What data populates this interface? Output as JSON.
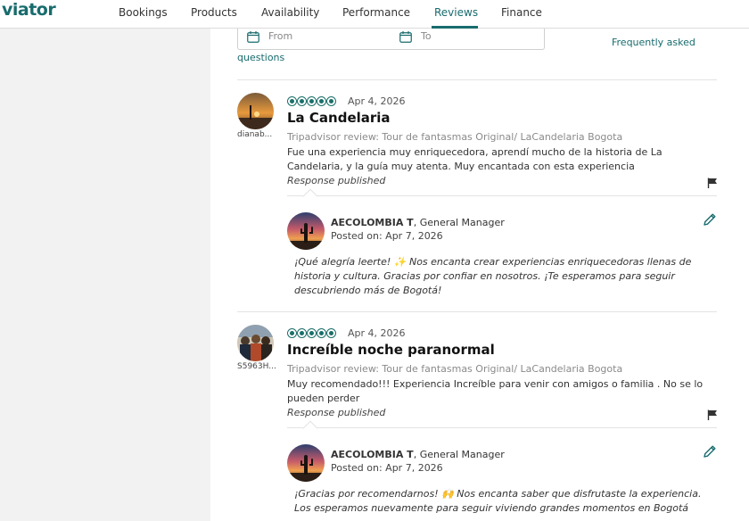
{
  "brand": {
    "logo": "viator",
    "accent": "#186b6d"
  },
  "nav": {
    "items": [
      {
        "label": "Bookings"
      },
      {
        "label": "Products"
      },
      {
        "label": "Availability"
      },
      {
        "label": "Performance"
      },
      {
        "label": "Reviews",
        "active": true
      },
      {
        "label": "Finance"
      }
    ]
  },
  "filters": {
    "from_placeholder": "From",
    "to_placeholder": "To",
    "faq_line1": "Frequently asked",
    "faq_line2": "questions"
  },
  "reviews": [
    {
      "username": "dianab...",
      "rating": 5,
      "date": "Apr 4, 2026",
      "title": "La Candelaria",
      "source": "Tripadvisor review: Tour de fantasmas Original/ LaCandelaria Bogota",
      "text": "Fue una experiencia muy enriquecedora, aprendí mucho de la historia de La Candelaria, y la guía muy atenta. Muy encantada con esta experiencia",
      "status": "Response published",
      "response": {
        "manager_name": "AECOLOMBIA T",
        "manager_role": ", General Manager",
        "posted_label": "Posted on:",
        "posted_date": "Apr 7, 2026",
        "text": "¡Qué alegría leerte! ✨ Nos encanta crear experiencias enriquecedoras llenas de historia y cultura. Gracias por confiar en nosotros. ¡Te esperamos para seguir descubriendo más de Bogotá!"
      }
    },
    {
      "username": "S5963H...",
      "rating": 5,
      "date": "Apr 4, 2026",
      "title": "Increíble noche paranormal",
      "source": "Tripadvisor review: Tour de fantasmas Original/ LaCandelaria Bogota",
      "text": "Muy recomendado!!! Experiencia Increíble para venir con amigos o familia . No se lo pueden perder",
      "status": "Response published",
      "response": {
        "manager_name": "AECOLOMBIA T",
        "manager_role": ", General Manager",
        "posted_label": "Posted on:",
        "posted_date": "Apr 7, 2026",
        "text": "¡Gracias por recomendarnos! 🙌 Nos encanta saber que disfrutaste la experiencia. Los esperamos nuevamente para seguir viviendo grandes momentos en Bogotá"
      }
    }
  ],
  "icons": {
    "calendar": "calendar-icon",
    "flag": "flag-icon",
    "edit": "pencil-icon",
    "star": "rating-bubble-icon"
  }
}
